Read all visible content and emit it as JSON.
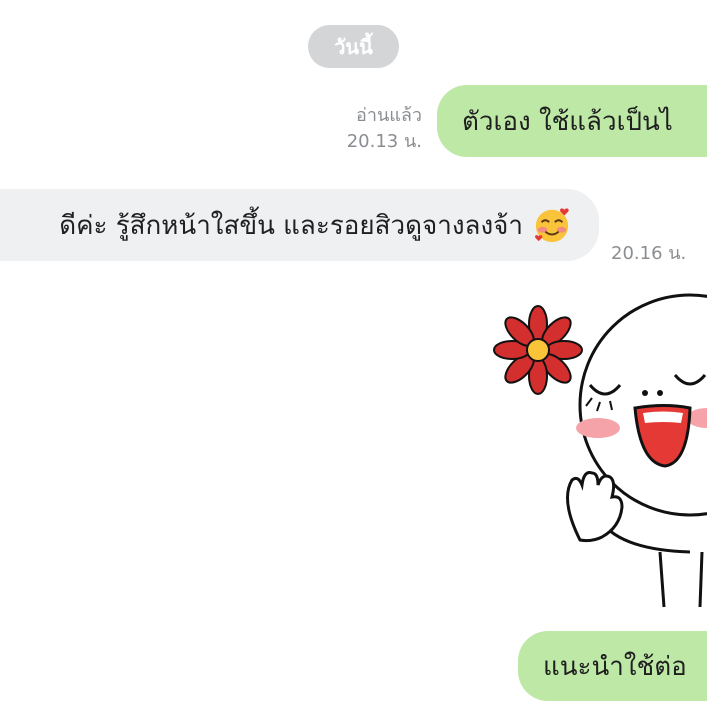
{
  "chat": {
    "date_divider": "วันนี้",
    "messages": [
      {
        "id": "m1",
        "direction": "outgoing",
        "text": "ตัวเอง ใช้แล้วเป็นไ",
        "status": "อ่านแล้ว",
        "time": "20.13 น."
      },
      {
        "id": "m2",
        "direction": "incoming",
        "text": "ดีค่ะ รู้สึกหน้าใสขึ้น และรอยสิวดูจางลงจ้า",
        "emoji": "smiling-face-with-hearts",
        "time": "20.16 น."
      },
      {
        "id": "m3",
        "direction": "outgoing",
        "type": "sticker",
        "sticker": "laughing-character-with-red-flower"
      },
      {
        "id": "m4",
        "direction": "outgoing",
        "text": "แนะนำใช้ต่อ"
      }
    ]
  },
  "colors": {
    "outgoing_bubble": "#bde8a6",
    "incoming_bubble": "#eff0f2",
    "date_pill": "#d4d5d7",
    "meta_text": "#8a8e92"
  }
}
